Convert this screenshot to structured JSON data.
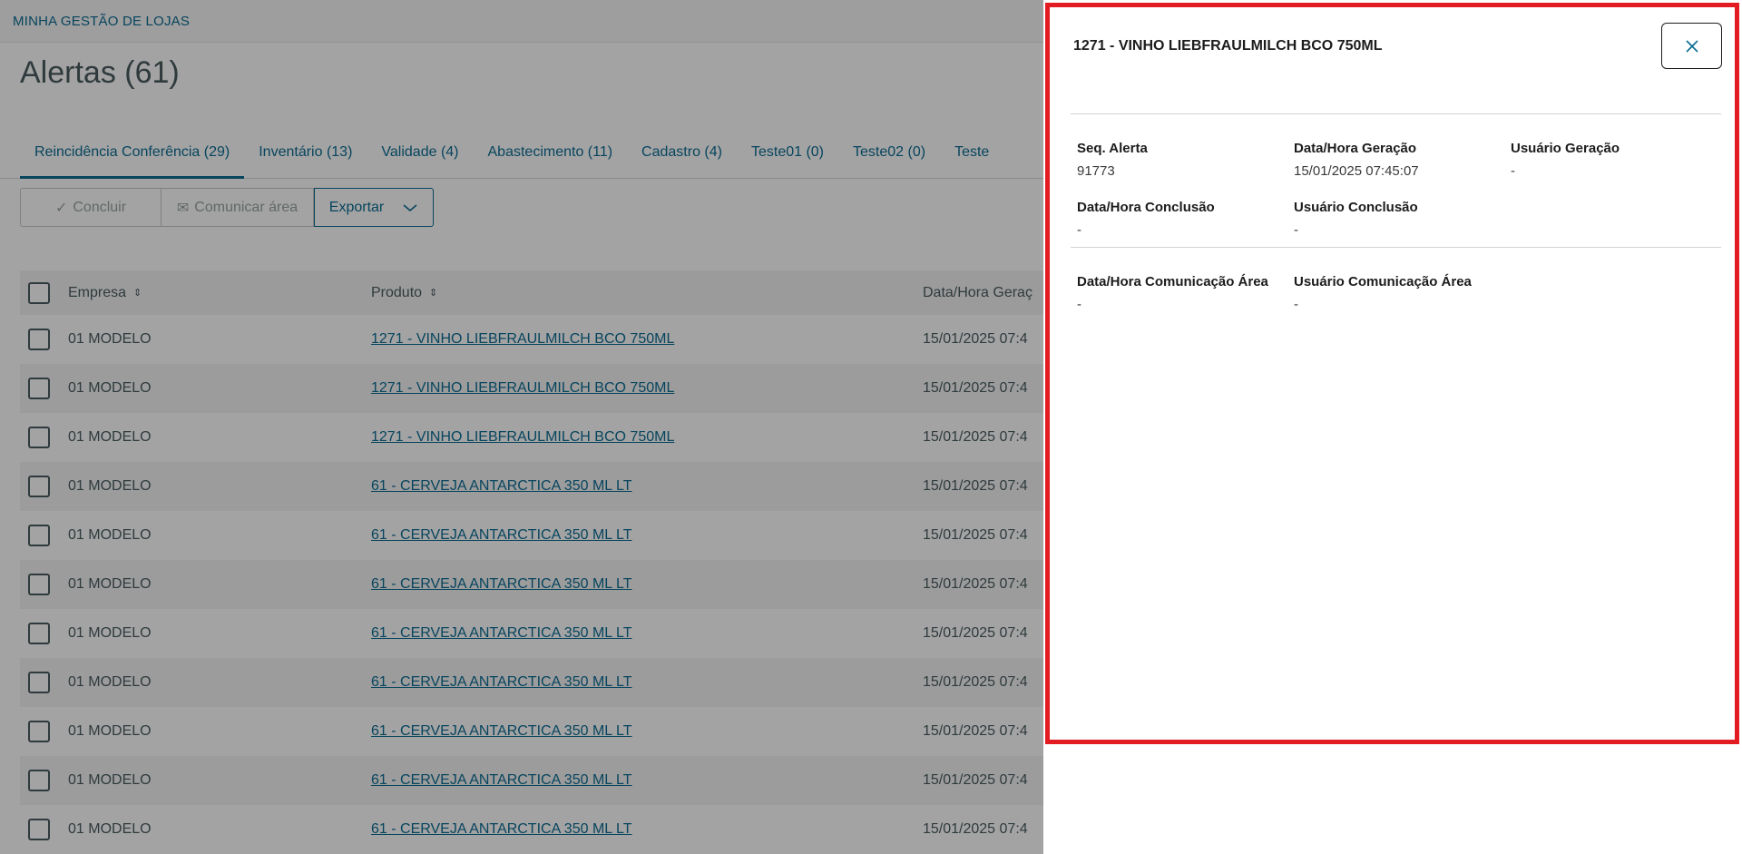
{
  "app": {
    "title": "MINHA GESTÃO DE LOJAS"
  },
  "page": {
    "title": "Alertas (61)"
  },
  "tabs": [
    {
      "label": "Reincidência Conferência (29)",
      "active": true
    },
    {
      "label": "Inventário (13)"
    },
    {
      "label": "Validade (4)"
    },
    {
      "label": "Abastecimento (11)"
    },
    {
      "label": "Cadastro (4)"
    },
    {
      "label": "Teste01 (0)"
    },
    {
      "label": "Teste02 (0)"
    },
    {
      "label": "Teste"
    }
  ],
  "toolbar": {
    "concluir_label": "Concluir",
    "comunicar_label": "Comunicar área",
    "exportar_label": "Exportar"
  },
  "grid": {
    "columns": {
      "empresa": "Empresa",
      "produto": "Produto",
      "data": "Data/Hora Geraç"
    },
    "rows": [
      {
        "empresa": "01 MODELO",
        "produto": "1271 - VINHO LIEBFRAULMILCH BCO 750ML",
        "data": "15/01/2025 07:4"
      },
      {
        "empresa": "01 MODELO",
        "produto": "1271 - VINHO LIEBFRAULMILCH BCO 750ML",
        "data": "15/01/2025 07:4"
      },
      {
        "empresa": "01 MODELO",
        "produto": "1271 - VINHO LIEBFRAULMILCH BCO 750ML",
        "data": "15/01/2025 07:4"
      },
      {
        "empresa": "01 MODELO",
        "produto": "61 - CERVEJA ANTARCTICA 350 ML LT",
        "data": "15/01/2025 07:4"
      },
      {
        "empresa": "01 MODELO",
        "produto": "61 - CERVEJA ANTARCTICA 350 ML LT",
        "data": "15/01/2025 07:4"
      },
      {
        "empresa": "01 MODELO",
        "produto": "61 - CERVEJA ANTARCTICA 350 ML LT",
        "data": "15/01/2025 07:4"
      },
      {
        "empresa": "01 MODELO",
        "produto": "61 - CERVEJA ANTARCTICA 350 ML LT",
        "data": "15/01/2025 07:4"
      },
      {
        "empresa": "01 MODELO",
        "produto": "61 - CERVEJA ANTARCTICA 350 ML LT",
        "data": "15/01/2025 07:4"
      },
      {
        "empresa": "01 MODELO",
        "produto": "61 - CERVEJA ANTARCTICA 350 ML LT",
        "data": "15/01/2025 07:4"
      },
      {
        "empresa": "01 MODELO",
        "produto": "61 - CERVEJA ANTARCTICA 350 ML LT",
        "data": "15/01/2025 07:4"
      },
      {
        "empresa": "01 MODELO",
        "produto": "61 - CERVEJA ANTARCTICA 350 ML LT",
        "data": "15/01/2025 07:4"
      }
    ]
  },
  "drawer": {
    "title": "1271 - VINHO LIEBFRAULMILCH BCO 750ML",
    "highlight_color": "#e31b23",
    "fields": {
      "seq_alerta": {
        "label": "Seq. Alerta",
        "value": "91773"
      },
      "data_geracao": {
        "label": "Data/Hora Geração",
        "value": "15/01/2025 07:45:07"
      },
      "usuario_geracao": {
        "label": "Usuário Geração",
        "value": "-"
      },
      "data_conclusao": {
        "label": "Data/Hora Conclusão",
        "value": "-"
      },
      "usuario_conclusao": {
        "label": "Usuário Conclusão",
        "value": "-"
      },
      "data_comunicacao": {
        "label": "Data/Hora Comunicação Área",
        "value": "-"
      },
      "usuario_comunicacao": {
        "label": "Usuário Comunicação Área",
        "value": "-"
      }
    }
  },
  "colors": {
    "accent": "#0c6c94",
    "text": "#4a5c60",
    "overlay": "rgba(0,0,0,0.36)"
  }
}
